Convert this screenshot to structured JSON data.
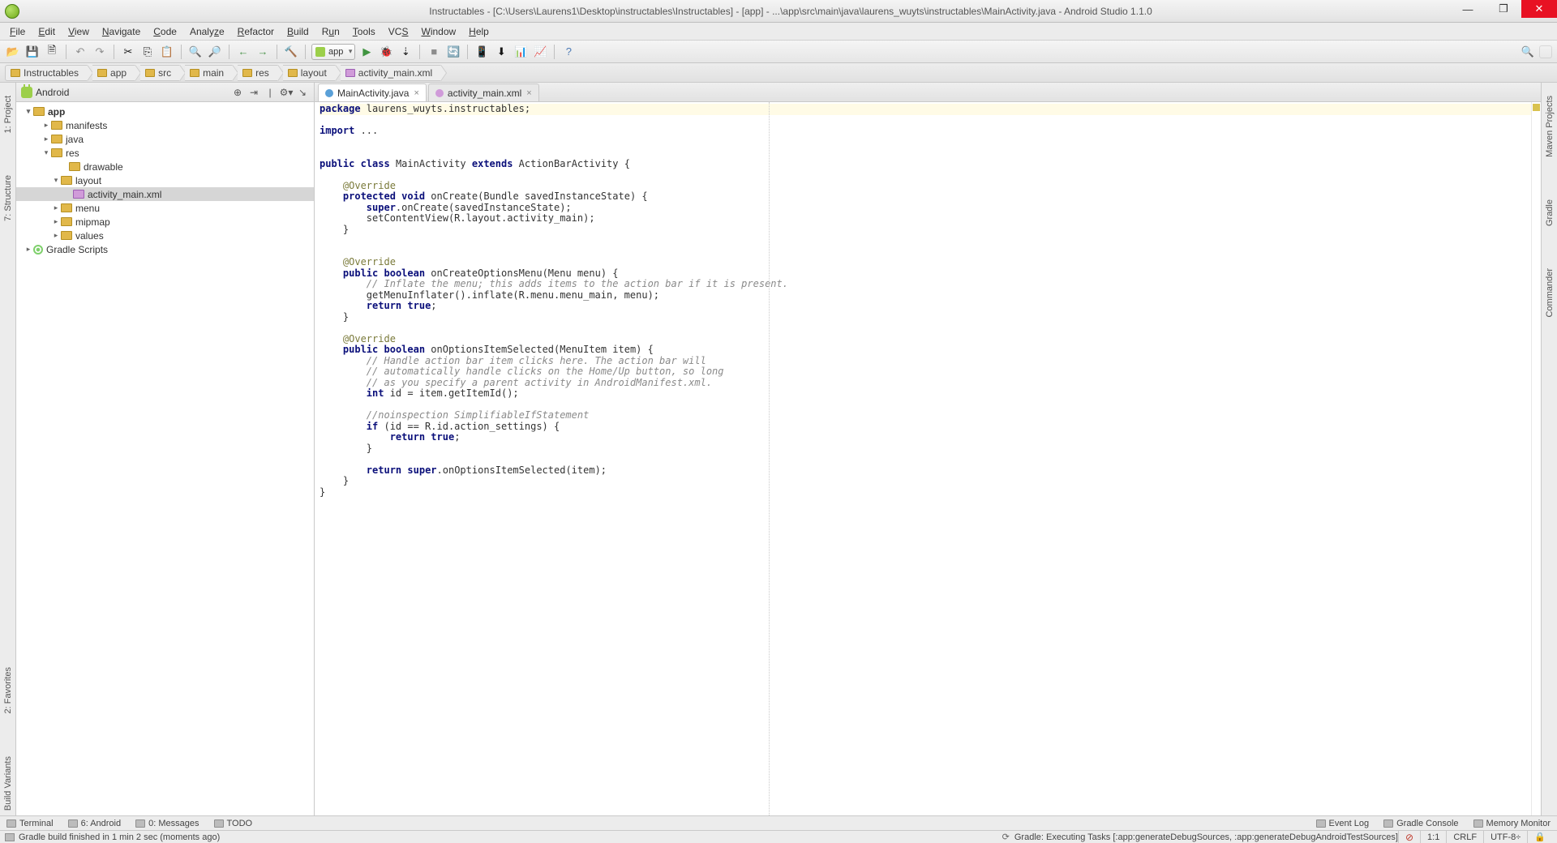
{
  "title": "Instructables - [C:\\Users\\Laurens1\\Desktop\\instructables\\Instructables] - [app] - ...\\app\\src\\main\\java\\laurens_wuyts\\instructables\\MainActivity.java - Android Studio 1.1.0",
  "menu": [
    "File",
    "Edit",
    "View",
    "Navigate",
    "Code",
    "Analyze",
    "Refactor",
    "Build",
    "Run",
    "Tools",
    "VCS",
    "Window",
    "Help"
  ],
  "run_config": "app",
  "breadcrumb": [
    "Instructables",
    "app",
    "src",
    "main",
    "res",
    "layout",
    "activity_main.xml"
  ],
  "project": {
    "view_label": "Android",
    "tree": {
      "app": "app",
      "manifests": "manifests",
      "java": "java",
      "res": "res",
      "drawable": "drawable",
      "layout": "layout",
      "activity_main": "activity_main.xml",
      "menu": "menu",
      "mipmap": "mipmap",
      "values": "values",
      "gradle": "Gradle Scripts"
    }
  },
  "tabs": [
    {
      "label": "MainActivity.java",
      "kind": "java",
      "active": true
    },
    {
      "label": "activity_main.xml",
      "kind": "xml",
      "active": false
    }
  ],
  "left_rail": [
    "1: Project",
    "7: Structure"
  ],
  "left_rail_b": [
    "2: Favorites",
    "Build Variants"
  ],
  "right_rail": [
    "Maven Projects",
    "Gradle",
    "Commander"
  ],
  "tool_tabs_left": [
    "Terminal",
    "6: Android",
    "0: Messages",
    "TODO"
  ],
  "tool_tabs_right": [
    "Event Log",
    "Gradle Console",
    "Memory Monitor"
  ],
  "status": {
    "left": "Gradle build finished in 1 min 2 sec (moments ago)",
    "task": "Gradle: Executing Tasks [:app:generateDebugSources, :app:generateDebugAndroidTestSources]",
    "pos": "1:1",
    "eol": "CRLF",
    "enc": "UTF-8"
  },
  "icons": {
    "open": "📂",
    "save": "💾",
    "saveall": "🗎",
    "undo": "↶",
    "redo": "↷",
    "cut": "✂",
    "copy": "⎘",
    "paste": "📋",
    "zoomin": "🔍",
    "zoomout": "🔎",
    "back": "←",
    "fwd": "→",
    "make": "🔨",
    "run": "▶",
    "debug": "🐞",
    "attach": "⇣",
    "stop": "■",
    "sync": "🔄",
    "avd": "📱",
    "sdk": "⬇",
    "ddms": "📊",
    "mem": "📈",
    "help": "?",
    "search": "🔍"
  },
  "code_tokens": {
    "package": "package",
    "pkg": " laurens_wuyts.instructables;",
    "import": "import",
    "ellipsis": " ...",
    "public": "public",
    "class": "class",
    "MainActivity": " MainActivity ",
    "extends": "extends",
    "ActionBarActivity": " ActionBarActivity {",
    "Override": "@Override",
    "protected": "protected",
    "void": "void",
    "onCreate": " onCreate(Bundle savedInstanceState) {",
    "superOnCreate": "super.onCreate(savedInstanceState);",
    "setContent": "setContentView(R.layout.activity_main);",
    "closeBrace": "}",
    "boolean": "boolean",
    "onCreateOptions": " onCreateOptionsMenu(Menu menu) {",
    "inflateComment": "// Inflate the menu; this adds items to the action bar if it is present.",
    "getMenuInflater": "getMenuInflater().inflate(R.menu.menu_main, menu);",
    "return": "return",
    "true": "true",
    "semi": ";",
    "onOptions": " onOptionsItemSelected(MenuItem item) {",
    "c1": "// Handle action bar item clicks here. The action bar will",
    "c2": "// automatically handle clicks on the Home/Up button, so long",
    "c3": "// as you specify a parent activity in AndroidManifest.xml.",
    "int": "int",
    "idline": " id = item.getItemId();",
    "noinspection": "//noinspection SimplifiableIfStatement",
    "if": "if",
    "ifcond": " (id == R.id.action_settings) {",
    "super": "super",
    "retsuper": ".onOptionsItemSelected(item);"
  }
}
